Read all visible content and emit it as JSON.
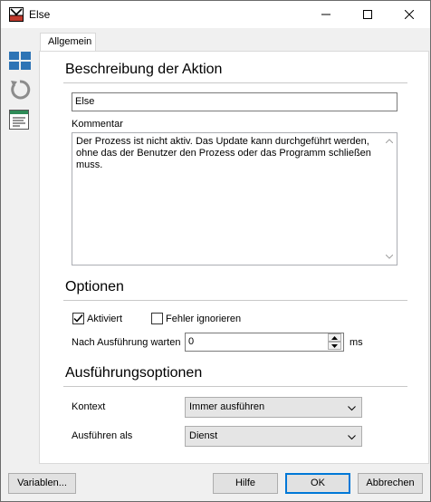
{
  "window": {
    "title": "Else"
  },
  "tabs": [
    {
      "label": "Allgemein"
    }
  ],
  "description_section": {
    "title": "Beschreibung der Aktion",
    "name_value": "Else",
    "comment_label": "Kommentar",
    "comment_value": "Der Prozess ist nicht aktiv. Das Update kann durchgeführt werden, ohne das der Benutzer den Prozess oder das Programm schließen muss."
  },
  "options_section": {
    "title": "Optionen",
    "activated_label": "Aktiviert",
    "activated_checked": true,
    "ignore_errors_label": "Fehler ignorieren",
    "ignore_errors_checked": false,
    "wait_label": "Nach Ausführung warten",
    "wait_value": "0",
    "wait_unit": "ms"
  },
  "execution_section": {
    "title": "Ausführungsoptionen",
    "context_label": "Kontext",
    "context_value": "Immer ausführen",
    "run_as_label": "Ausführen als",
    "run_as_value": "Dienst"
  },
  "footer": {
    "variables_label": "Variablen...",
    "help_label": "Hilfe",
    "ok_label": "OK",
    "cancel_label": "Abbrechen"
  },
  "colors": {
    "accent": "#0078d7",
    "sidebar_icon_blue": "#2e74b5"
  }
}
